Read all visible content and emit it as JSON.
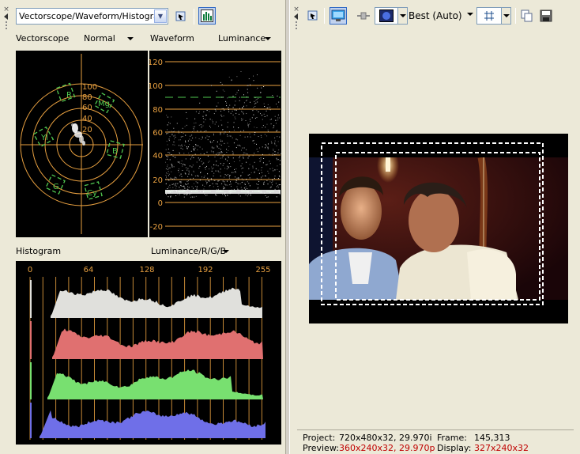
{
  "left": {
    "scope_select": {
      "value": "Vectorscope/Waveform/Histogram"
    },
    "vectorscope": {
      "label": "Vectorscope",
      "mode": "Normal",
      "ring_labels": [
        "100",
        "80",
        "60",
        "40",
        "20"
      ],
      "targets": [
        "R",
        "Mg",
        "B",
        "Cy",
        "G",
        "Yl"
      ]
    },
    "waveform": {
      "label": "Waveform",
      "mode": "Luminance",
      "ticks": [
        "120",
        "100",
        "80",
        "60",
        "40",
        "20",
        "0",
        "-20"
      ]
    },
    "histogram": {
      "label": "Histogram",
      "mode": "Luminance/R/G/B",
      "ticks": [
        "0",
        "64",
        "128",
        "192",
        "255"
      ],
      "channels": [
        {
          "name": "luminance",
          "color": "#e0e0dc"
        },
        {
          "name": "red",
          "color": "#e07070"
        },
        {
          "name": "green",
          "color": "#78e070"
        },
        {
          "name": "blue",
          "color": "#6f6fe8"
        }
      ]
    }
  },
  "right": {
    "quality": "Best (Auto)",
    "status": {
      "project_label": "Project:",
      "project_value": "720x480x32, 29.970i",
      "frame_label": "Frame:",
      "frame_value": "145,313",
      "preview_label": "Preview:",
      "preview_value": "360x240x32, 29.970p",
      "display_label": "Display:",
      "display_value": "327x240x32"
    }
  },
  "colors": {
    "scope_grid": "#e8a040",
    "scope_green": "#50c850",
    "status_value_red": "#c00000"
  }
}
